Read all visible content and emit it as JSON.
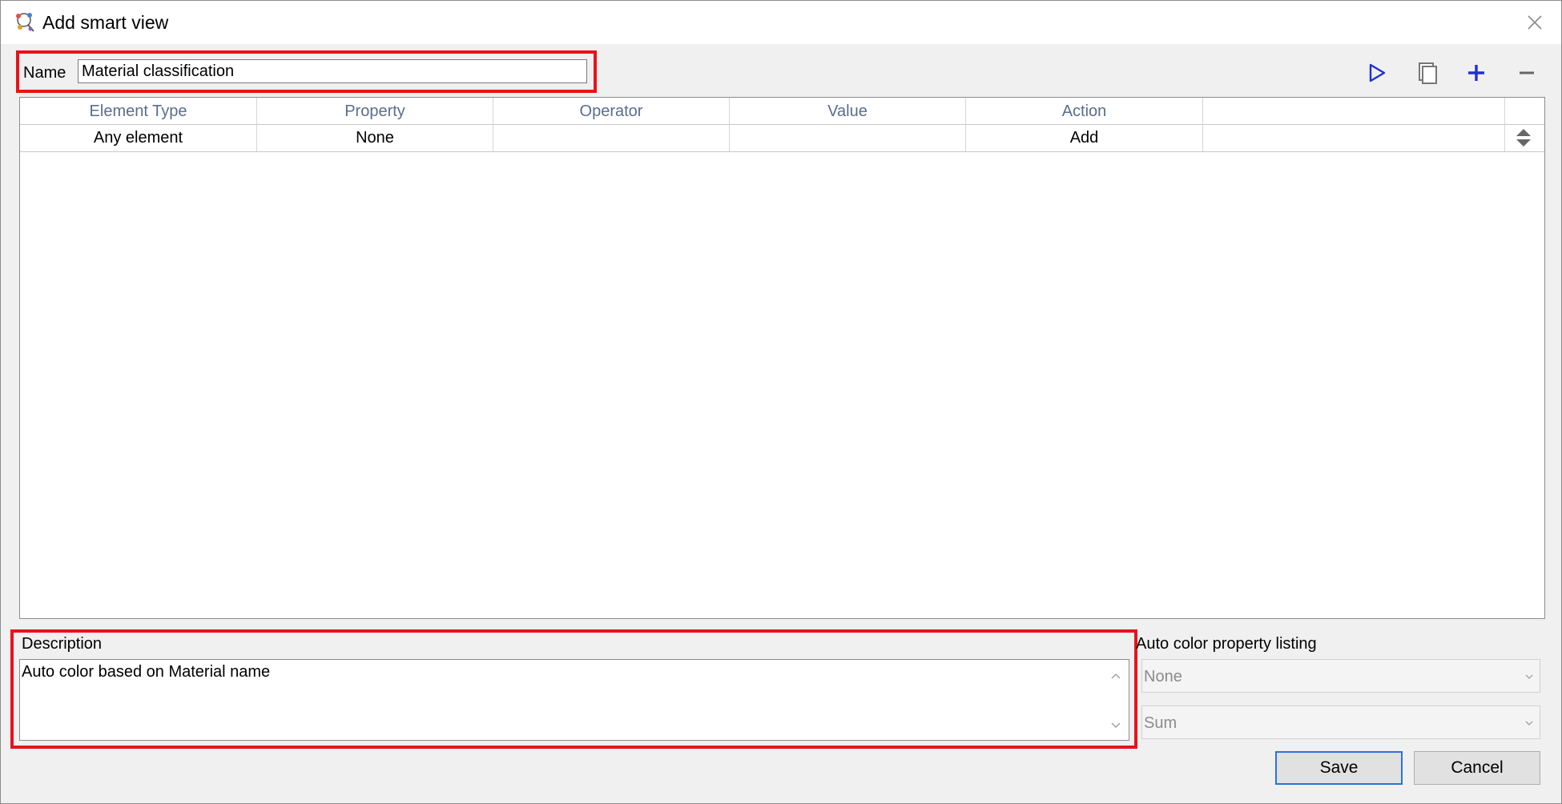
{
  "window": {
    "title": "Add smart view"
  },
  "name": {
    "label": "Name",
    "value": "Material classification"
  },
  "toolbar": {
    "run_icon": "play-icon",
    "copy_icon": "copy-icon",
    "add_icon": "plus-icon",
    "remove_icon": "minus-icon",
    "accent_color": "#1f2fd6"
  },
  "grid": {
    "columns": [
      "Element Type",
      "Property",
      "Operator",
      "Value",
      "Action"
    ],
    "rows": [
      {
        "element_type": "Any element",
        "property": "None",
        "operator": "",
        "value": "",
        "action": "Add"
      }
    ]
  },
  "description": {
    "label": "Description",
    "value": "Auto color based on Material name"
  },
  "auto_color": {
    "label": "Auto color property listing",
    "property": "None",
    "aggregate": "Sum"
  },
  "buttons": {
    "save": "Save",
    "cancel": "Cancel"
  },
  "colors": {
    "highlight": "#e8121a",
    "header_text": "#5a6d8c"
  }
}
